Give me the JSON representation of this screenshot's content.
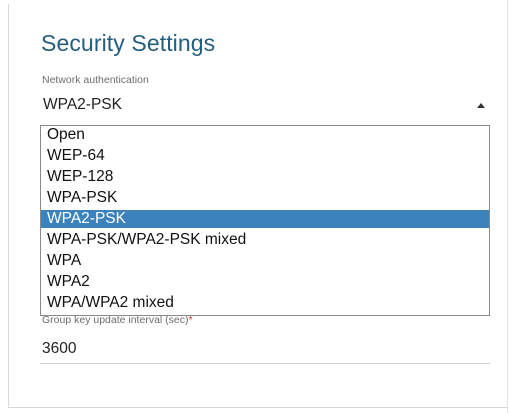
{
  "page": {
    "title": "Security Settings"
  },
  "auth": {
    "label": "Network authentication",
    "selected": "WPA2-PSK",
    "options": [
      "Open",
      "WEP-64",
      "WEP-128",
      "WPA-PSK",
      "WPA2-PSK",
      "WPA-PSK/WPA2-PSK mixed",
      "WPA",
      "WPA2",
      "WPA/WPA2 mixed"
    ]
  },
  "group_key": {
    "label": "Group key update interval (sec)",
    "required_mark": "*",
    "value": "3600"
  },
  "colors": {
    "title": "#245e7e",
    "highlight": "#3c82bd",
    "required": "#c0392b"
  }
}
